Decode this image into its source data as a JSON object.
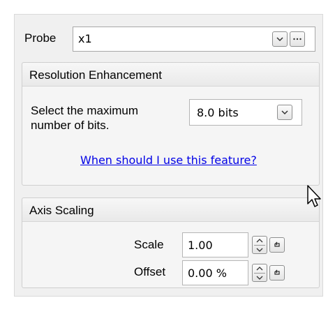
{
  "probe": {
    "label": "Probe",
    "value": "x1",
    "icons": [
      "chevron-down-icon",
      "ellipsis-icon"
    ]
  },
  "resolution": {
    "title": "Resolution Enhancement",
    "description_line1": "Select the maximum",
    "description_line2": "number of bits.",
    "value": "8.0 bits",
    "link": "When should I use this feature?"
  },
  "axis_scaling": {
    "title": "Axis Scaling",
    "scale_label": "Scale",
    "scale_value": "1.00",
    "offset_label": "Offset",
    "offset_value": "0.00 %",
    "icons": [
      "spin-up-down-icon",
      "reset-icon"
    ]
  },
  "colors": {
    "link": "#0000e6",
    "panel_bg": "#f0f0f0"
  }
}
